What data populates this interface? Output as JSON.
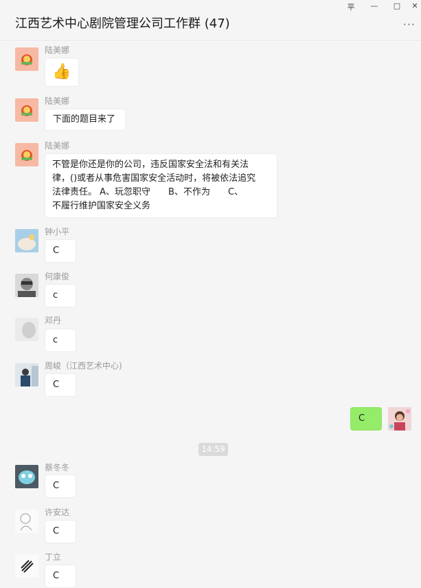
{
  "window": {
    "title": "江西艺术中心剧院管理公司工作群 (47)",
    "controls": {
      "pin": "平",
      "minimize": "—",
      "maximize": "□",
      "close": "✕"
    },
    "more": "···"
  },
  "messages": [
    {
      "sender": "陆美娜",
      "content": "👍",
      "icon": "thumbs-up-icon"
    },
    {
      "sender": "陆美娜",
      "content": "下面的题目来了"
    },
    {
      "sender": "陆美娜",
      "lines": [
        "不管是你还是你的公司，违反国家安全法和有关法",
        "律，()或者从事危害国家安全活动时，将被依法追究",
        "法律责任。 A、玩忽职守　　B、不作为　　C、",
        "不履行维护国家安全义务"
      ]
    },
    {
      "sender": "钟小平",
      "content": "C"
    },
    {
      "sender": "何康俊",
      "content": "c"
    },
    {
      "sender": "邓丹",
      "content": "c"
    },
    {
      "sender": "周峻（江西艺术中心)",
      "content": "C"
    },
    {
      "sender": "",
      "content": "C",
      "self": true
    }
  ],
  "time_divider": "14:59",
  "messages_after": [
    {
      "sender": "蔡冬冬",
      "content": "C"
    },
    {
      "sender": "许安达",
      "content": "C"
    },
    {
      "sender": "丁立",
      "content": "C"
    }
  ],
  "colors": {
    "self_bubble": "#95ec69",
    "background": "#f5f5f5",
    "bubble": "#ffffff"
  }
}
